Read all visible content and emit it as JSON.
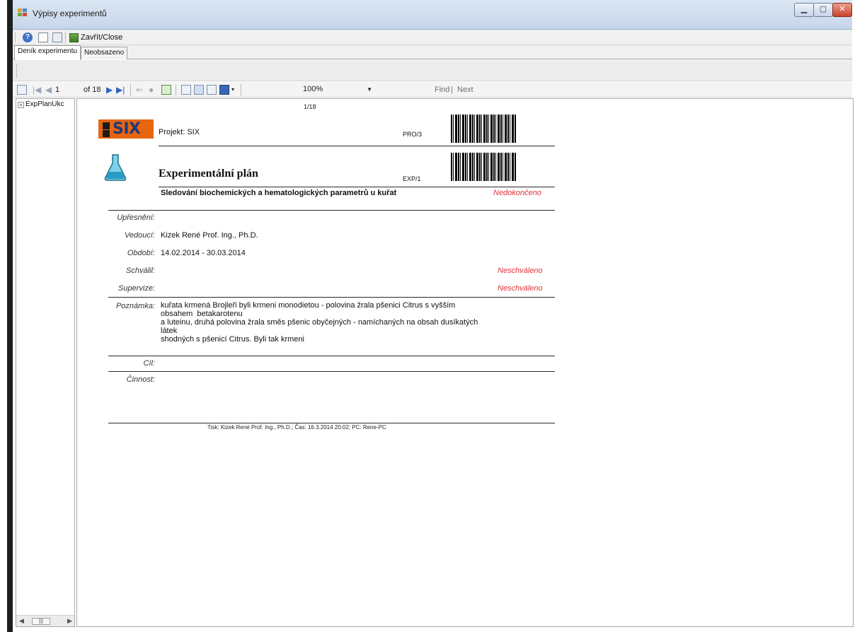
{
  "window": {
    "title": "Výpisy experimentů"
  },
  "toolbar": {
    "close_label": "Zavřít/Close",
    "help_icon_text": "?"
  },
  "tabs": [
    {
      "label": "Deník experimentu"
    },
    {
      "label": "Neobsazeno"
    }
  ],
  "report_toolbar": {
    "page_current": "1",
    "page_of": "of 18",
    "zoom": "100%",
    "find_label": "Find",
    "next_label": "Next"
  },
  "tree": {
    "item": "ExpPlanUkc"
  },
  "report": {
    "page_indicator": "1/18",
    "logo_text": "SIX",
    "project": "Projekt: SIX",
    "pro_code": "PRO/3",
    "exp_code": "EXP/1",
    "title": "Experimentální plán",
    "subtitle": "Sledování biochemických a hematologických parametrů u kuřat",
    "status": "Nedokončeno",
    "fields": {
      "upresneni_label": "Upřesnění:",
      "upresneni_value": "",
      "vedouci_label": "Vedoucí:",
      "vedouci_value": "Kizek René Prof. Ing., Ph.D.",
      "obdobi_label": "Období:",
      "obdobi_value": "14.02.2014  -  30.03.2014",
      "schvalil_label": "Schválil:",
      "schvalil_status": "Neschváleno",
      "supervize_label": "Supervize:",
      "supervize_status": "Neschváleno",
      "poznamka_label": "Poznámka:",
      "poznamka_lines": [
        "kuřata krmená Brojleři byli krmeni monodietou - polovina žrala pšenici Citrus s vyšším",
        "obsahem  betakarotenu",
        "a luteinu, druhá polovina žrala směs pšenic obyčejných - namíchaných na obsah dusíkatých",
        "látek",
        "shodných s pšenicí Citrus. Byli tak krmeni"
      ],
      "cil_label": "Cíl:",
      "cinnost_label": "Činnost:"
    },
    "footer": "Tisk: Kizek René Prof. Ing., Ph.D.; Čas: 16.3.2014 20:02; PC: Rene-PC"
  },
  "colors": {
    "status_red": "#e0303a",
    "logo_orange": "#e8650f",
    "logo_blue": "#1e3a7a"
  }
}
